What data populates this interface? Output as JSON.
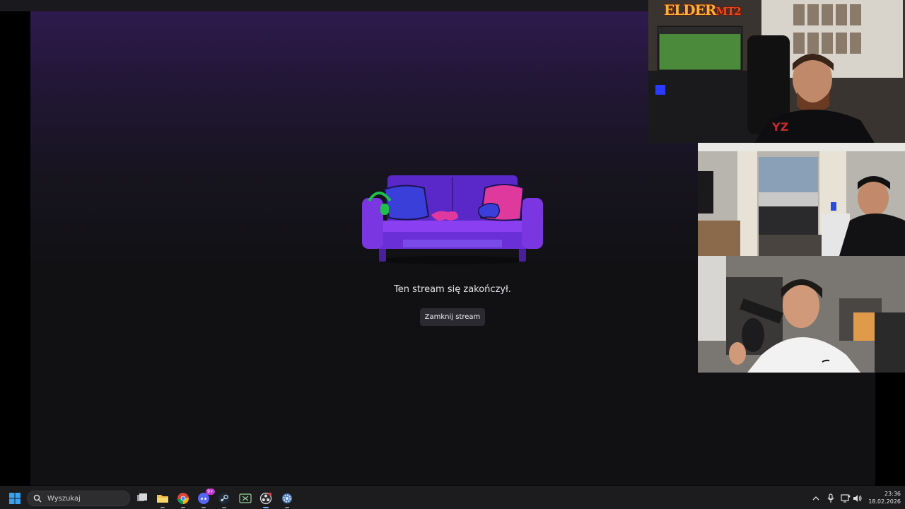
{
  "stream": {
    "end_message": "Ten stream się zakończył.",
    "close_button_label": "Zamknij stream"
  },
  "webcams": {
    "cam1_logo_text": "ELDER",
    "cam1_logo_suffix": "MT2"
  },
  "taskbar": {
    "search_placeholder": "Wyszukaj",
    "discord_badge": "9+",
    "apps": [
      {
        "icon": "task-view-icon"
      },
      {
        "icon": "file-explorer-icon"
      },
      {
        "icon": "chrome-icon"
      },
      {
        "icon": "discord-icon"
      },
      {
        "icon": "steam-icon"
      },
      {
        "icon": "xbox-icon"
      },
      {
        "icon": "obs-icon"
      },
      {
        "icon": "settings-icon"
      }
    ],
    "clock": {
      "time": "23:36",
      "date": "18.02.2026"
    }
  },
  "colors": {
    "accent": "#6fb6ff",
    "background_top": "#2e1a4e",
    "background_bottom": "#111114",
    "sofa_main": "#6a2fd6",
    "button_bg": "#2a2a30"
  }
}
